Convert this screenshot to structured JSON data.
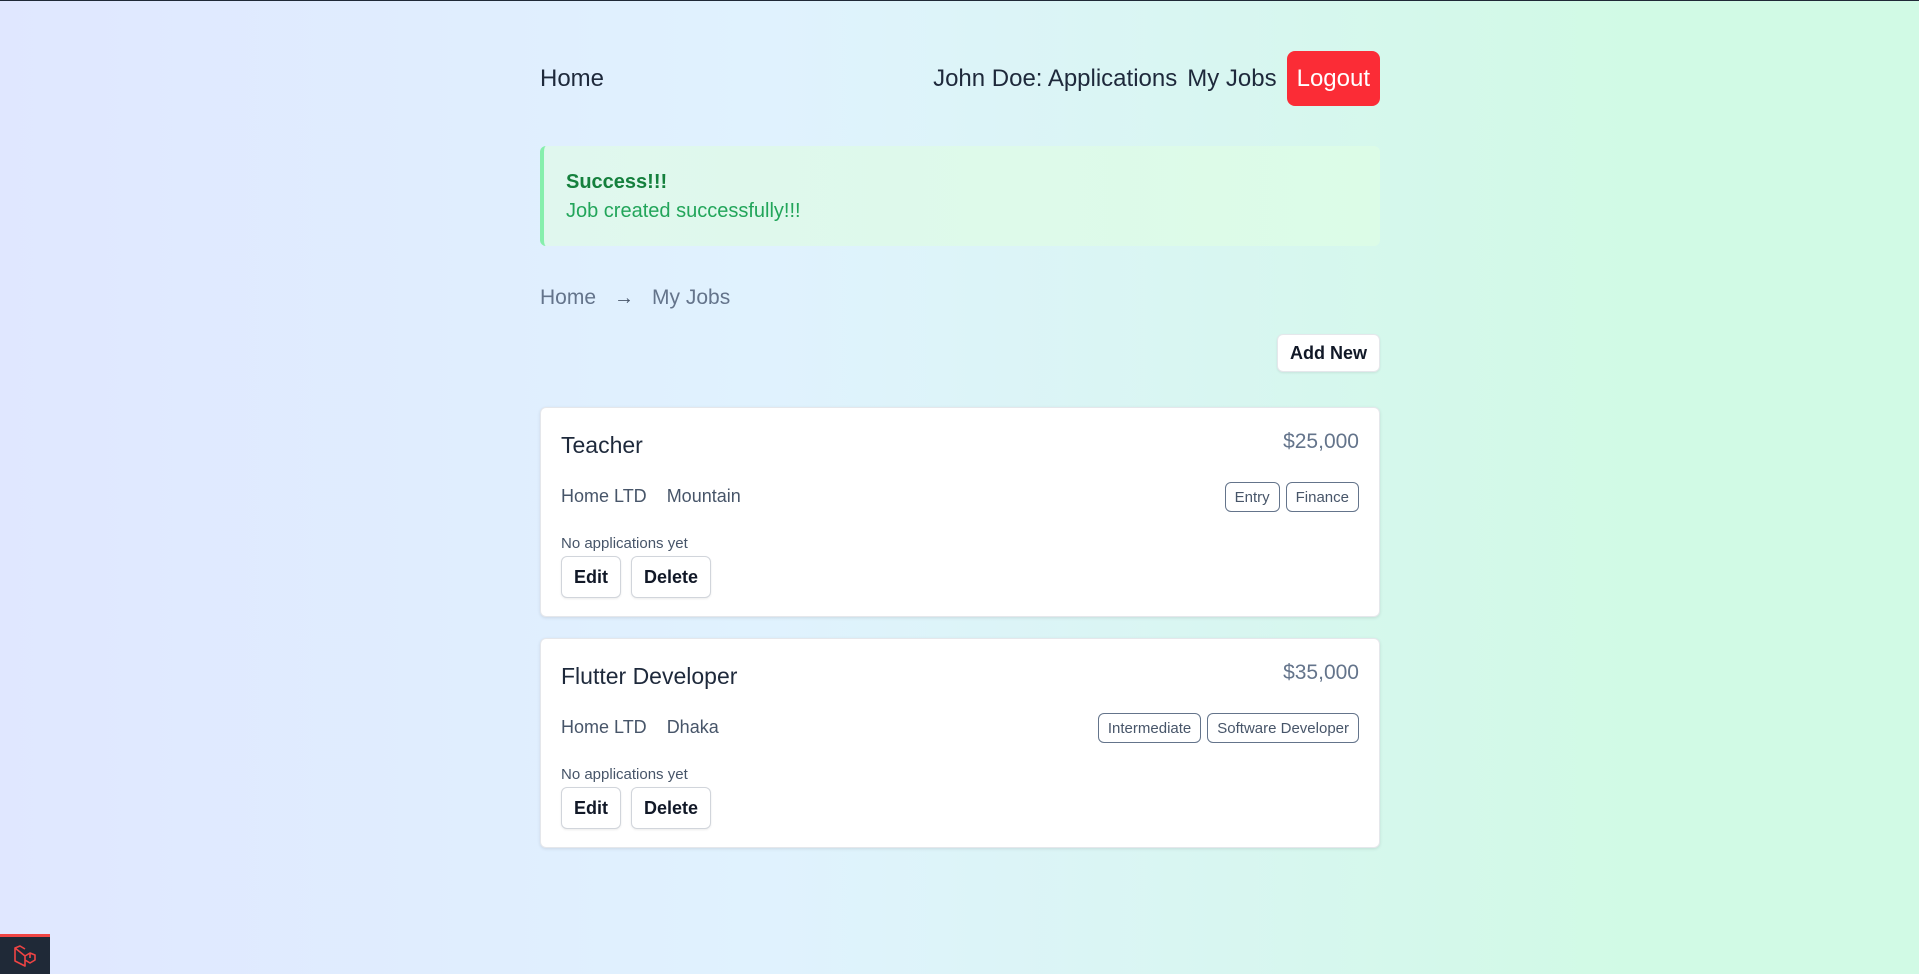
{
  "nav": {
    "home_label": "Home",
    "applications_label": "John Doe: Applications",
    "my_jobs_label": "My Jobs",
    "logout_label": "Logout"
  },
  "alert": {
    "title": "Success!!!",
    "message": "Job created successfully!!!"
  },
  "breadcrumb": {
    "home": "Home",
    "separator": "→",
    "current": "My Jobs"
  },
  "actions": {
    "add_new_label": "Add New"
  },
  "jobs": [
    {
      "title": "Teacher",
      "salary": "$25,000",
      "company": "Home LTD",
      "location": "Mountain",
      "tags": [
        "Entry",
        "Finance"
      ],
      "status": "No applications yet",
      "edit_label": "Edit",
      "delete_label": "Delete"
    },
    {
      "title": "Flutter Developer",
      "salary": "$35,000",
      "company": "Home LTD",
      "location": "Dhaka",
      "tags": [
        "Intermediate",
        "Software Developer"
      ],
      "status": "No applications yet",
      "edit_label": "Edit",
      "delete_label": "Delete"
    }
  ],
  "colors": {
    "logout_bg": "#fb2c36",
    "alert_text": "#16a34a",
    "alert_border": "#86efac"
  },
  "icons": {
    "breadcrumb_separator": "arrow-right-icon",
    "debug_widget": "laravel-logo-icon"
  }
}
